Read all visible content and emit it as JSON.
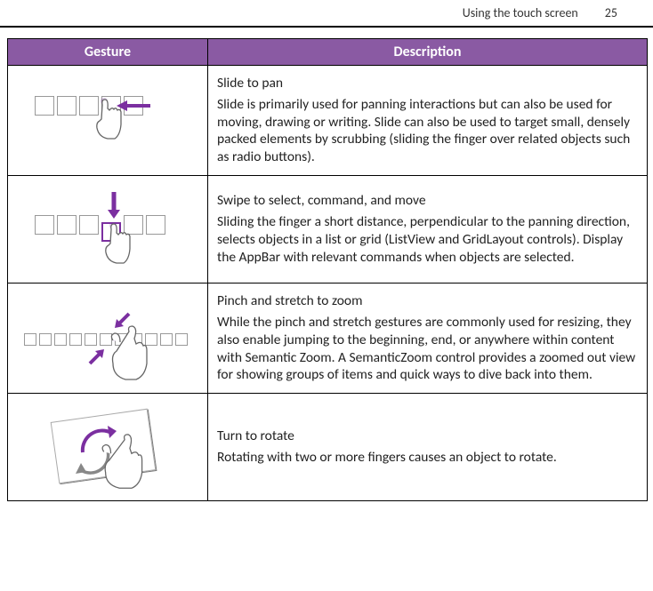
{
  "section_title": "Using the touch screen",
  "page_number": "25",
  "table": {
    "headers": {
      "gesture": "Gesture",
      "description": "Description"
    },
    "rows": [
      {
        "title": "Slide to pan",
        "body": "Slide is primarily used for panning interactions but can also be used for moving, drawing or writing. Slide can also be used to target small, densely packed elements by scrubbing (sliding the finger over related objects such as radio buttons)."
      },
      {
        "title": "Swipe to select, command, and move",
        "body": "Sliding the finger a short distance, perpendicular to the panning direction, selects objects in a list or grid (ListView and GridLayout controls). Display the AppBar with relevant commands when objects are selected."
      },
      {
        "title": "Pinch and stretch to zoom",
        "body": "While the pinch and stretch gestures are commonly used for resizing, they also enable jumping to the beginning, end, or anywhere within content with Semantic Zoom. A SemanticZoom control provides a zoomed out view for showing groups of items and quick ways to dive back into them."
      },
      {
        "title": "Turn to rotate",
        "body": "Rotating with two or more fingers causes an object to rotate."
      }
    ]
  },
  "colors": {
    "accent": "#7b2fa0",
    "header_bg": "#8a5aa3"
  }
}
